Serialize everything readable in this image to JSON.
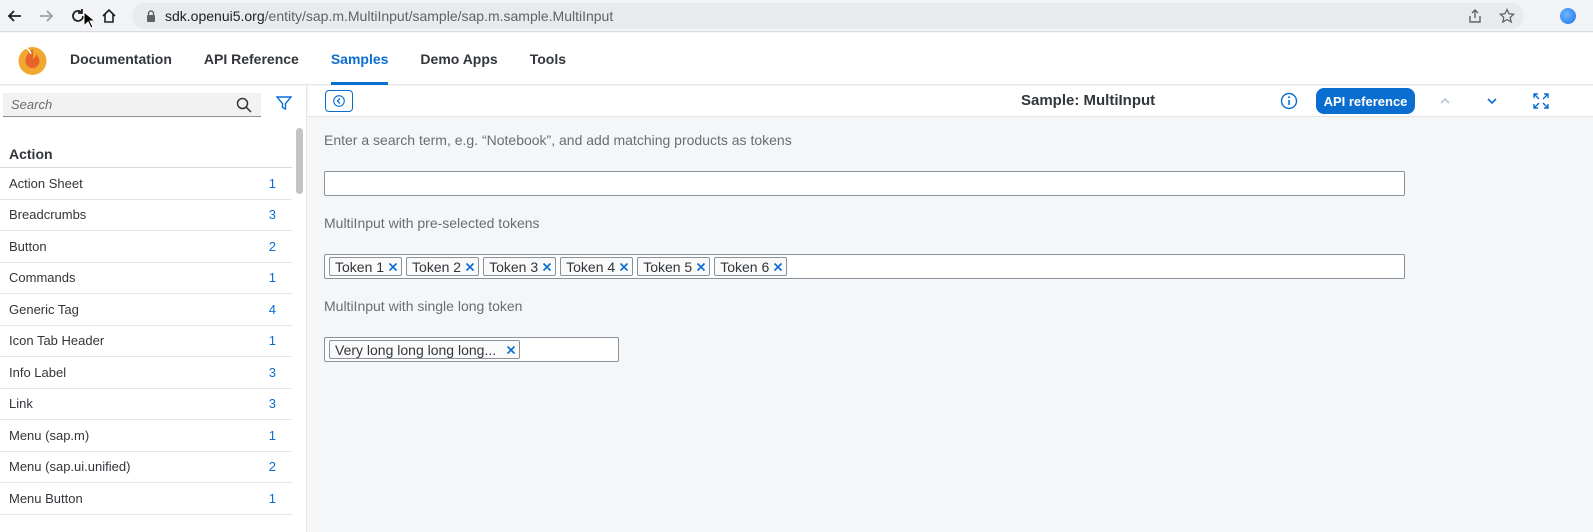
{
  "browser": {
    "url_host": "sdk.openui5.org",
    "url_path": "/entity/sap.m.MultiInput/sample/sap.m.sample.MultiInput"
  },
  "colors": {
    "accent": "#0a6ed1",
    "logo": "#f0a830"
  },
  "nav": {
    "items": [
      {
        "label": "Documentation"
      },
      {
        "label": "API Reference"
      },
      {
        "label": "Samples"
      },
      {
        "label": "Demo Apps"
      },
      {
        "label": "Tools"
      }
    ],
    "active": "Samples"
  },
  "sidebar": {
    "search_placeholder": "Search",
    "group": "Action",
    "items": [
      {
        "label": "Action Sheet",
        "count": "1"
      },
      {
        "label": "Breadcrumbs",
        "count": "3"
      },
      {
        "label": "Button",
        "count": "2"
      },
      {
        "label": "Commands",
        "count": "1"
      },
      {
        "label": "Generic Tag",
        "count": "4"
      },
      {
        "label": "Icon Tab Header",
        "count": "1"
      },
      {
        "label": "Info Label",
        "count": "3"
      },
      {
        "label": "Link",
        "count": "3"
      },
      {
        "label": "Menu (sap.m)",
        "count": "1"
      },
      {
        "label": "Menu (sap.ui.unified)",
        "count": "2"
      },
      {
        "label": "Menu Button",
        "count": "1"
      }
    ]
  },
  "toolbar": {
    "title": "Sample: MultiInput",
    "api_button": "API reference"
  },
  "content": {
    "label1": "Enter a search term, e.g. “Notebook”, and add matching products as tokens",
    "input1_value": "",
    "label2": "MultiInput with pre-selected tokens",
    "tokens": [
      "Token 1",
      "Token 2",
      "Token 3",
      "Token 4",
      "Token 5",
      "Token 6"
    ],
    "label3": "MultiInput with single long token",
    "long_token": "Very long long long long..."
  }
}
